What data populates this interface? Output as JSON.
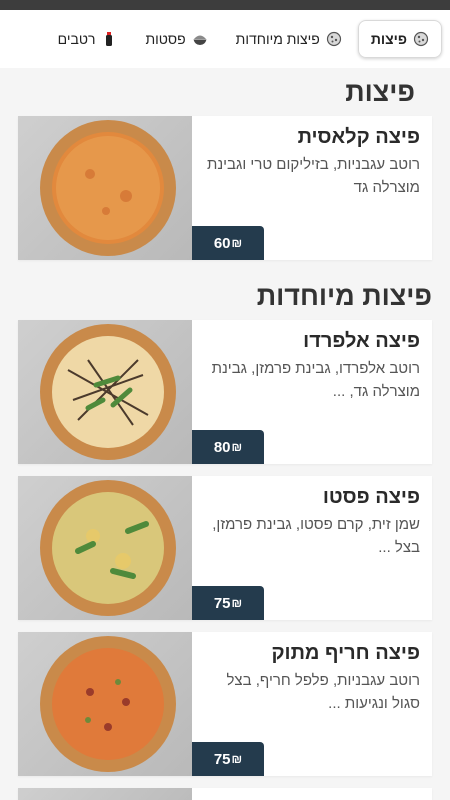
{
  "tabs": [
    {
      "label": "פיצות",
      "icon": "pizza-icon",
      "active": true
    },
    {
      "label": "פיצות מיוחדות",
      "icon": "pizza-icon",
      "active": false
    },
    {
      "label": "פסטות",
      "icon": "pasta-bowl-icon",
      "active": false
    },
    {
      "label": "רטבים",
      "icon": "sauce-bottle-icon",
      "active": false
    }
  ],
  "sections": [
    {
      "title": "פיצות",
      "items": [
        {
          "name": "פיצה קלאסית",
          "desc": "רוטב עגבניות, בזיליקום טרי וגבינת מוצרלה גד",
          "price": "60",
          "currency": "₪"
        }
      ]
    },
    {
      "title": "פיצות מיוחדות",
      "items": [
        {
          "name": "פיצה אלפרדו",
          "desc": "רוטב אלפרדו, גבינת פרמזן, גבינת מוצרלה גד, ...",
          "price": "80",
          "currency": "₪"
        },
        {
          "name": "פיצה פסטו",
          "desc": "שמן זית, קרם פסטו, גבינת פרמזן, בצל ...",
          "price": "75",
          "currency": "₪"
        },
        {
          "name": "פיצה חריף מתוק",
          "desc": "רוטב עגבניות, פלפל חריף, בצל סגול ונגיעות ...",
          "price": "75",
          "currency": "₪"
        }
      ]
    }
  ],
  "colors": {
    "price_bg": "#243b4d",
    "page_bg": "#f5f5f5"
  }
}
